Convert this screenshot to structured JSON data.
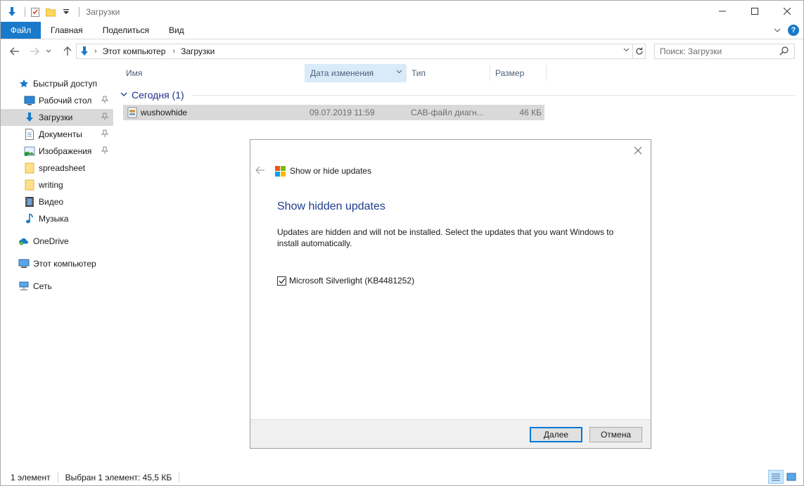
{
  "window": {
    "title": "Загрузки"
  },
  "ribbon": {
    "tabs": [
      "Файл",
      "Главная",
      "Поделиться",
      "Вид"
    ]
  },
  "address": {
    "crumbs": [
      "Этот компьютер",
      "Загрузки"
    ],
    "search_placeholder": "Поиск: Загрузки"
  },
  "sidebar": {
    "quick_access": "Быстрый доступ",
    "items": [
      {
        "label": "Рабочий стол",
        "icon": "desktop-icon",
        "pinned": true
      },
      {
        "label": "Загрузки",
        "icon": "downloads-icon",
        "pinned": true,
        "selected": true
      },
      {
        "label": "Документы",
        "icon": "documents-icon",
        "pinned": true
      },
      {
        "label": "Изображения",
        "icon": "pictures-icon",
        "pinned": true
      },
      {
        "label": "spreadsheet",
        "icon": "folder-icon",
        "pinned": false
      },
      {
        "label": "writing",
        "icon": "folder-icon",
        "pinned": false
      },
      {
        "label": "Видео",
        "icon": "video-icon",
        "pinned": false
      },
      {
        "label": "Музыка",
        "icon": "music-icon",
        "pinned": false
      }
    ],
    "onedrive": "OneDrive",
    "this_pc": "Этот компьютер",
    "network": "Сеть"
  },
  "filelist": {
    "columns": [
      "Имя",
      "Дата изменения",
      "Тип",
      "Размер"
    ],
    "group_title": "Сегодня (1)",
    "rows": [
      {
        "name": "wushowhide",
        "date": "09.07.2019 11:59",
        "type": "CAB-файл диагн...",
        "size": "46 КБ"
      }
    ]
  },
  "status": {
    "count": "1 элемент",
    "selection": "Выбран 1 элемент: 45,5 КБ"
  },
  "dialog": {
    "app_title": "Show or hide updates",
    "heading": "Show hidden updates",
    "body": "Updates are hidden and will not be installed. Select the updates that you want Windows to install automatically.",
    "update_item": "Microsoft Silverlight (KB4481252)",
    "update_checked": true,
    "next_button": "Далее",
    "cancel_button": "Отмена"
  },
  "colors": {
    "accent": "#1979ca",
    "selection": "#d9d9d9",
    "heading_blue": "#1e3c8c"
  }
}
